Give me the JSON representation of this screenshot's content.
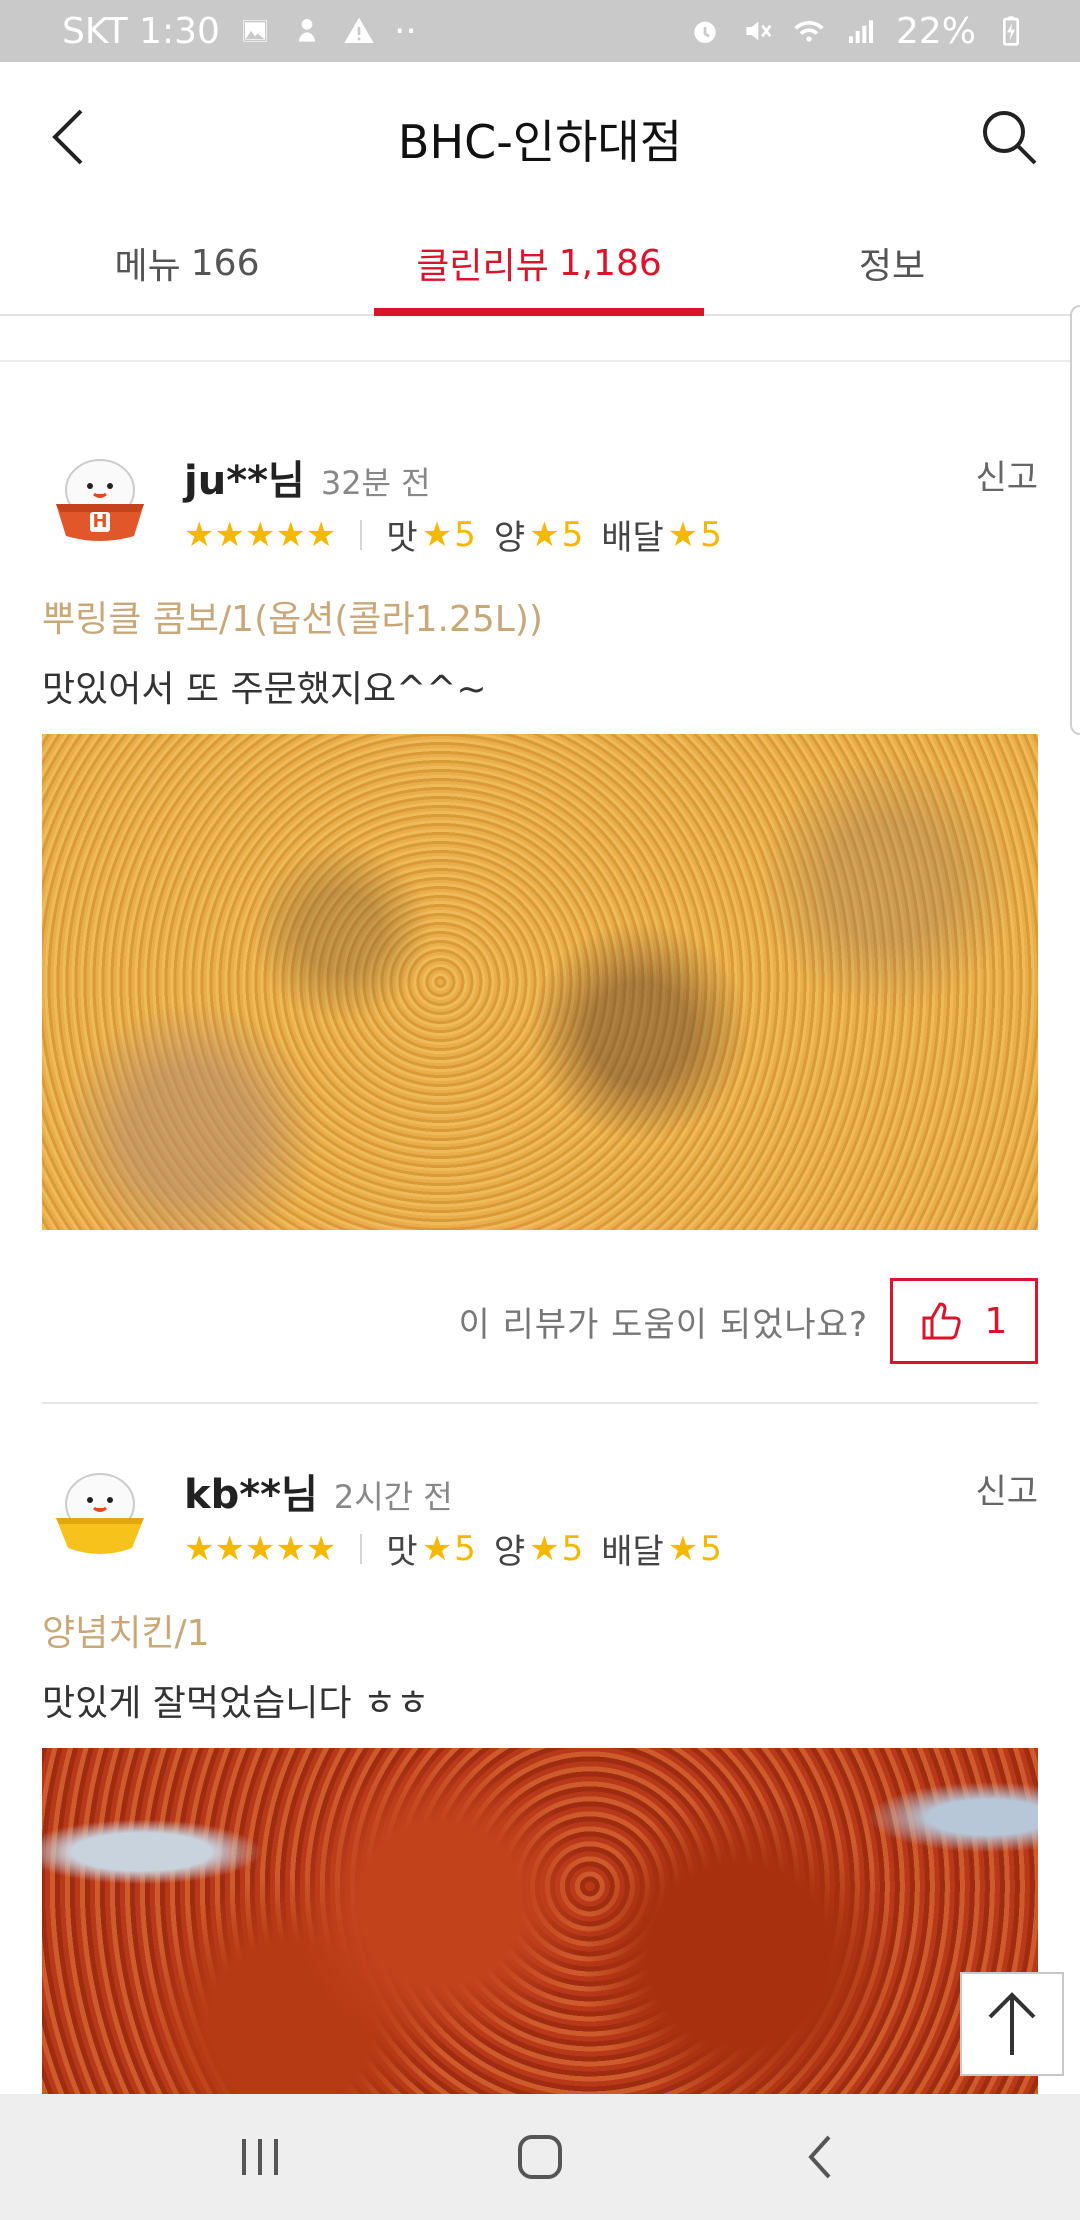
{
  "status_bar": {
    "carrier_time": "SKT 1:30",
    "dots": "··",
    "battery": "22%"
  },
  "header": {
    "title": "BHC-인하대점"
  },
  "tabs": [
    {
      "label": "메뉴",
      "count": "166",
      "active": false
    },
    {
      "label": "클린리뷰",
      "count": "1,186",
      "active": true
    },
    {
      "label": "정보",
      "count": "",
      "active": false
    }
  ],
  "reviews": [
    {
      "username": "ju**님",
      "time": "32분 전",
      "report": "신고",
      "stars": "★★★★★",
      "sub_ratings": [
        {
          "label": "맛",
          "star": "★",
          "value": "5"
        },
        {
          "label": "양",
          "star": "★",
          "value": "5"
        },
        {
          "label": "배달",
          "star": "★",
          "value": "5"
        }
      ],
      "order_item": "뿌링클 콤보/1(옵션(콜라1.25L))",
      "text": "맛있어서 또 주문했지요^^~",
      "helpful_question": "이 리뷰가 도움이 되었나요?",
      "likes": "1",
      "avatar_letter": "H"
    },
    {
      "username": "kb**님",
      "time": "2시간 전",
      "report": "신고",
      "stars": "★★★★★",
      "sub_ratings": [
        {
          "label": "맛",
          "star": "★",
          "value": "5"
        },
        {
          "label": "양",
          "star": "★",
          "value": "5"
        },
        {
          "label": "배달",
          "star": "★",
          "value": "5"
        }
      ],
      "order_item": "양념치킨/1",
      "text": "맛있게 잘먹었습니다 ㅎㅎ"
    }
  ],
  "icons": {
    "back": "back-arrow-icon",
    "search": "search-icon",
    "thumbs_up": "thumbs-up-icon",
    "scroll_top": "arrow-up-icon",
    "nav_recent": "recent-apps-icon",
    "nav_home": "home-icon",
    "nav_back": "nav-back-icon"
  },
  "colors": {
    "accent": "#d9142b",
    "star": "#f5b800",
    "order_item": "#c8a878",
    "status_bar": "#c9c9c9"
  }
}
